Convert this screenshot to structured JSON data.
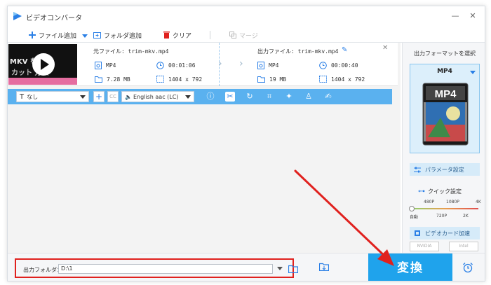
{
  "app": {
    "title": "ビデオコンバータ"
  },
  "toolbar": {
    "add_file": "ファイル追加",
    "add_folder": "フォルダ追加",
    "clear": "クリア",
    "merge": "マージ"
  },
  "file": {
    "source_label": "元ファイル: trim-mkv.mp4",
    "output_label": "出力ファイル: trim-mkv.mp4",
    "thumb_text1": "MKV を",
    "thumb_text2": "カット 方法",
    "source": {
      "format": "MP4",
      "duration": "00:01:06",
      "size": "7.28 MB",
      "resolution": "1404 x 792"
    },
    "output": {
      "format": "MP4",
      "duration": "00:00:40",
      "size": "19 MB",
      "resolution": "1404 x 792"
    }
  },
  "editbar": {
    "subtitle_value": "なし",
    "audio_value": "English aac (LC)"
  },
  "bottom": {
    "output_folder_label": "出力フォルダ：",
    "output_folder_value": "D:\\1",
    "convert_label": "変換"
  },
  "right_panel": {
    "format_select_title": "出力フォーマットを選択",
    "format_name": "MP4",
    "format_icon_text": "MP4",
    "params_label": "パラメータ設定",
    "quick_label": "クイック設定",
    "quality_top": [
      "480P",
      "1080P",
      "4K"
    ],
    "quality_bottom": [
      "自動",
      "720P",
      "2K"
    ],
    "quality_position": 0,
    "gpu_label": "ビデオカード加速",
    "gpu_nvidia": "NVIDIA",
    "gpu_intel": "Intel"
  },
  "colors": {
    "accent": "#1fa3ec",
    "editbar": "#5ab1ef",
    "highlight": "#e0211e"
  }
}
